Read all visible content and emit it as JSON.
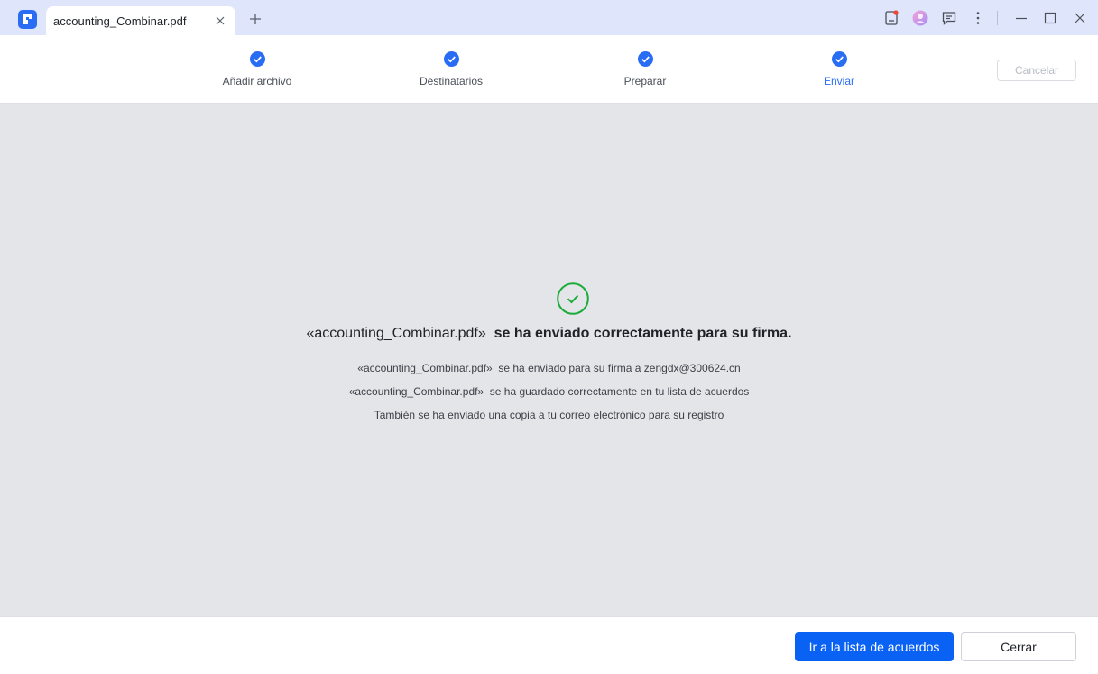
{
  "titlebar": {
    "tab_title": "accounting_Combinar.pdf",
    "icons": [
      "app-logo-icon",
      "close-icon",
      "plus-icon",
      "notification-icon",
      "avatar-icon",
      "feedback-icon",
      "more-icon",
      "minimize-icon",
      "maximize-icon",
      "window-close-icon"
    ]
  },
  "stepper": {
    "steps": [
      {
        "label": "Añadir archivo",
        "status": "done"
      },
      {
        "label": "Destinatarios",
        "status": "done"
      },
      {
        "label": "Preparar",
        "status": "done"
      },
      {
        "label": "Enviar",
        "status": "active"
      }
    ],
    "cancel_label": "Cancelar"
  },
  "main": {
    "headline_file": "«accounting_Combinar.pdf»",
    "headline_text": "se ha enviado correctamente para su firma.",
    "lines": [
      {
        "file": "«accounting_Combinar.pdf»",
        "text": "se ha enviado para su firma a zengdx@300624.cn"
      },
      {
        "file": "«accounting_Combinar.pdf»",
        "text": "se ha guardado correctamente en tu lista de acuerdos"
      },
      {
        "file": "",
        "text": "También se ha enviado una copia a tu correo electrónico para su registro"
      }
    ]
  },
  "footer": {
    "primary_label": "Ir a la lista de acuerdos",
    "secondary_label": "Cerrar"
  },
  "colors": {
    "accent": "#2a6df5",
    "primary_button": "#0a62f5",
    "success": "#1aab3a",
    "titlebar_bg": "#dfe6fb",
    "content_bg": "#e4e5e8"
  }
}
